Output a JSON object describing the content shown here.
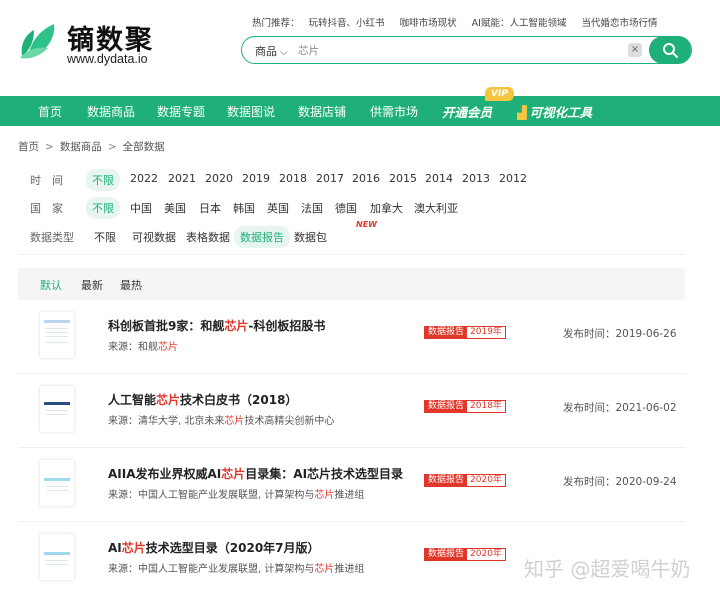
{
  "brand": {
    "name": "镝数聚",
    "url": "www.dydata.io",
    "accent": "#1fb07a"
  },
  "hot": {
    "label": "热门推荐：",
    "items": [
      "玩转抖音、小红书",
      "咖啡市场现状",
      "AI赋能：人工智能领域",
      "当代婚恋市场行情"
    ]
  },
  "search": {
    "category": "商品",
    "value": "芯片",
    "clear": "×"
  },
  "nav": {
    "items": [
      "首页",
      "数据商品",
      "数据专题",
      "数据图说",
      "数据店铺",
      "供需市场"
    ],
    "vip": "开通会员",
    "vip_tag": "VIP",
    "viz": "可视化工具"
  },
  "breadcrumb": [
    "首页",
    "数据商品",
    "全部数据"
  ],
  "filters": {
    "time": {
      "label": "时　间",
      "options": [
        "不限",
        "2022",
        "2021",
        "2020",
        "2019",
        "2018",
        "2017",
        "2016",
        "2015",
        "2014",
        "2013",
        "2012"
      ]
    },
    "country": {
      "label": "国　家",
      "options": [
        "不限",
        "中国",
        "美国",
        "日本",
        "韩国",
        "英国",
        "法国",
        "德国",
        "加拿大",
        "澳大利亚"
      ]
    },
    "type": {
      "label": "数据类型",
      "options": [
        "不限",
        "可视数据",
        "表格数据",
        "数据报告",
        "数据包"
      ],
      "new_badge": "NEW"
    }
  },
  "sort": [
    "默认",
    "最新",
    "最热"
  ],
  "results": [
    {
      "title_a": "科创板首批9家：和舰",
      "title_hl": "芯片",
      "title_b": "-科创板招股书",
      "source_prefix": "来源：",
      "source_a": "和舰",
      "source_hl": "芯片",
      "source_b": "",
      "tag_type": "数据报告",
      "tag_year": "2019年",
      "date": "发布时间：2019-06-26"
    },
    {
      "title_a": "人工智能",
      "title_hl": "芯片",
      "title_b": "技术白皮书（2018）",
      "source_prefix": "来源：",
      "source_a": "清华大学, 北京未来",
      "source_hl": "芯片",
      "source_b": "技术高精尖创新中心",
      "tag_type": "数据报告",
      "tag_year": "2018年",
      "date": "发布时间：2021-06-02"
    },
    {
      "title_a": "AIIA发布业界权威AI",
      "title_hl": "芯片",
      "title_b": "目录集：AI芯片技术选型目录",
      "source_prefix": "来源：",
      "source_a": "中国人工智能产业发展联盟, 计算架构与",
      "source_hl": "芯片",
      "source_b": "推进组",
      "tag_type": "数据报告",
      "tag_year": "2020年",
      "date": "发布时间：2020-09-24"
    },
    {
      "title_a": "AI",
      "title_hl": "芯片",
      "title_b": "技术选型目录（2020年7月版）",
      "source_prefix": "来源：",
      "source_a": "中国人工智能产业发展联盟, 计算架构与",
      "source_hl": "芯片",
      "source_b": "推进组",
      "tag_type": "数据报告",
      "tag_year": "2020年",
      "date": ""
    }
  ],
  "watermark": "知乎 @超爱喝牛奶"
}
